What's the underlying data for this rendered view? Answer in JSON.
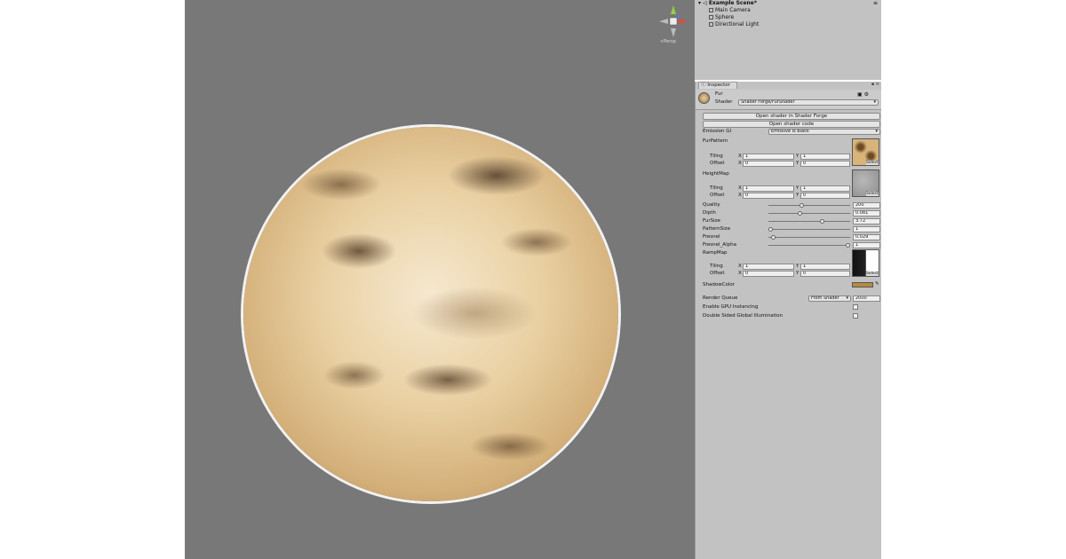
{
  "hierarchy": {
    "scene_name": "Example Scene*",
    "items": [
      "Main Camera",
      "Sphere",
      "Directional Light"
    ]
  },
  "scene_view": {
    "gizmo_label": "Persp"
  },
  "inspector": {
    "tab_label": "Inspector",
    "material_name": "Fur",
    "shader_label": "Shader",
    "shader_value": "Shader Forge/FurShader",
    "open_shader_forge": "Open shader in Shader Forge",
    "open_shader_code": "Open shader code",
    "emission_gi_label": "Emission GI",
    "emission_gi_value": "Emissive Is Black",
    "fur_pattern": {
      "label": "FurPattern",
      "tiling_label": "Tiling",
      "offset_label": "Offset",
      "tiling_x": "1",
      "tiling_y": "1",
      "offset_x": "0",
      "offset_y": "0",
      "select": "Select"
    },
    "height_map": {
      "label": "HeightMap",
      "tiling_label": "Tiling",
      "offset_label": "Offset",
      "tiling_x": "1",
      "tiling_y": "1",
      "offset_x": "0",
      "offset_y": "0",
      "select": "Select"
    },
    "sliders": [
      {
        "label": "Quality",
        "value": "200",
        "fraction": 0.4
      },
      {
        "label": "Dipth",
        "value": "0.081",
        "fraction": 0.38
      },
      {
        "label": "FurSize",
        "value": "3.72",
        "fraction": 0.67
      },
      {
        "label": "PatternSize",
        "value": "1",
        "fraction": 0.0
      },
      {
        "label": "Fresnel",
        "value": "0.029",
        "fraction": 0.03
      },
      {
        "label": "Fresnel_Alpha",
        "value": "1",
        "fraction": 1.0
      }
    ],
    "ramp_map": {
      "label": "RampMap",
      "tiling_label": "Tiling",
      "offset_label": "Offset",
      "tiling_x": "1",
      "tiling_y": "1",
      "offset_x": "0",
      "offset_y": "0",
      "select": "Select"
    },
    "shadow_color_label": "ShadowColor",
    "shadow_color": "#b88a40",
    "render_queue_label": "Render Queue",
    "render_queue_mode": "From Shader",
    "render_queue_value": "2000",
    "gpu_instancing_label": "Enable GPU Instancing",
    "double_sided_gi_label": "Double Sided Global Illumination",
    "axis_x": "X",
    "axis_y": "Y"
  }
}
